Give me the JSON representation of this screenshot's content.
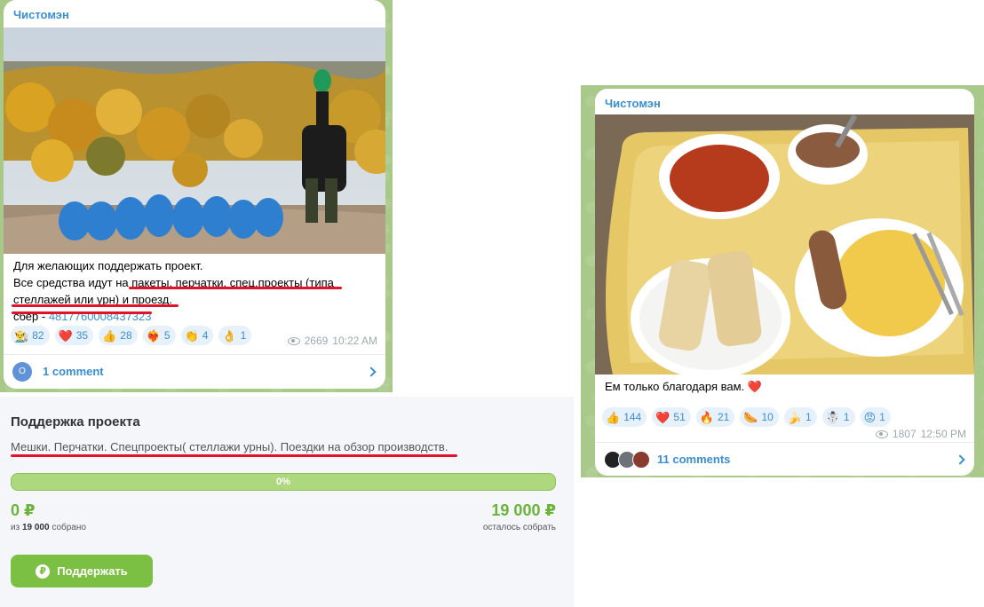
{
  "post1": {
    "channel": "Чистомэн",
    "lines": [
      "Для желающих поддержать проект.",
      "Все средства идут на пакеты, перчатки, спец.проекты (типа",
      "стеллажей или урн) и проезд."
    ],
    "sber_label": "сбер - ",
    "card_number": "4817760008437323",
    "reactions": [
      {
        "emoji": "👨‍🌾",
        "count": "82"
      },
      {
        "emoji": "❤️",
        "count": "35"
      },
      {
        "emoji": "👍",
        "count": "28"
      },
      {
        "emoji": "❤️‍🔥",
        "count": "5"
      },
      {
        "emoji": "👏",
        "count": "4"
      },
      {
        "emoji": "👌",
        "count": "1"
      }
    ],
    "views": "2669",
    "time": "10:22 AM",
    "avatar_letter": "O",
    "comments": "1 comment"
  },
  "post2": {
    "channel": "Чистомэн",
    "text": "Ем только благодаря вам. ❤️",
    "reactions": [
      {
        "emoji": "👍",
        "count": "144"
      },
      {
        "emoji": "❤️",
        "count": "51"
      },
      {
        "emoji": "🔥",
        "count": "21"
      },
      {
        "emoji": "🌭",
        "count": "10"
      },
      {
        "emoji": "🍌",
        "count": "1"
      },
      {
        "emoji": "☃️",
        "count": "1"
      },
      {
        "emoji": "😡",
        "count": "1"
      }
    ],
    "views": "1807",
    "time": "12:50 PM",
    "comments": "11 comments"
  },
  "donate": {
    "title": "Поддержка проекта",
    "description": "Мешки. Перчатки. Спецпроекты( стеллажи урны). Поездки на обзор производств.",
    "progress_label": "0%",
    "progress_fraction": 0,
    "collected": "0 ₽",
    "collected_prefix": "из ",
    "goal": "19 000",
    "collected_suffix": " собрано",
    "remaining": "19 000 ₽",
    "remaining_label": "осталось собрать",
    "button_label": "Поддержать",
    "accent_color": "#7cc043"
  },
  "colors": {
    "link": "#3a8ed4",
    "underline": "#e3112a",
    "chat_bg": "#a9c98a"
  }
}
